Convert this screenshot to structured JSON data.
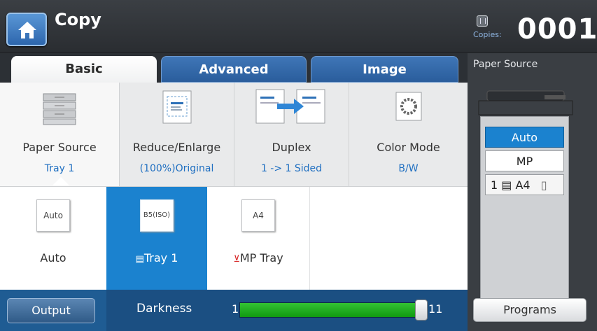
{
  "header": {
    "title": "Copy",
    "copies_label": "Copies:",
    "copies_value": "0001"
  },
  "tabs": [
    {
      "label": "Basic",
      "active": true
    },
    {
      "label": "Advanced",
      "active": false
    },
    {
      "label": "Image",
      "active": false
    }
  ],
  "options": [
    {
      "label": "Paper Source",
      "value": "Tray 1",
      "icon": "paper-stack-icon"
    },
    {
      "label": "Reduce/Enlarge",
      "value": "(100%)Original",
      "icon": "reduce-enlarge-icon"
    },
    {
      "label": "Duplex",
      "value": "1 -> 1 Sided",
      "icon": "duplex-icon"
    },
    {
      "label": "Color Mode",
      "value": "B/W",
      "icon": "color-mode-icon"
    }
  ],
  "trays": [
    {
      "label": "Auto",
      "thumb": "Auto",
      "selected": false
    },
    {
      "label": "Tray 1",
      "thumb": "B5(ISO)",
      "selected": true
    },
    {
      "label": "MP Tray",
      "thumb": "A4",
      "selected": false
    }
  ],
  "bottom": {
    "output_label": "Output",
    "darkness_label": "Darkness",
    "min": "1",
    "max": "11",
    "level_fraction": 1.0
  },
  "side": {
    "title": "Paper Source",
    "sources": {
      "auto": "Auto",
      "mp": "MP",
      "tray_num": "1",
      "tray_size": "A4"
    },
    "programs_label": "Programs"
  },
  "colors": {
    "accent": "#1b82cf",
    "value_text": "#1f6fc1",
    "bar_fill": "#22b022"
  }
}
